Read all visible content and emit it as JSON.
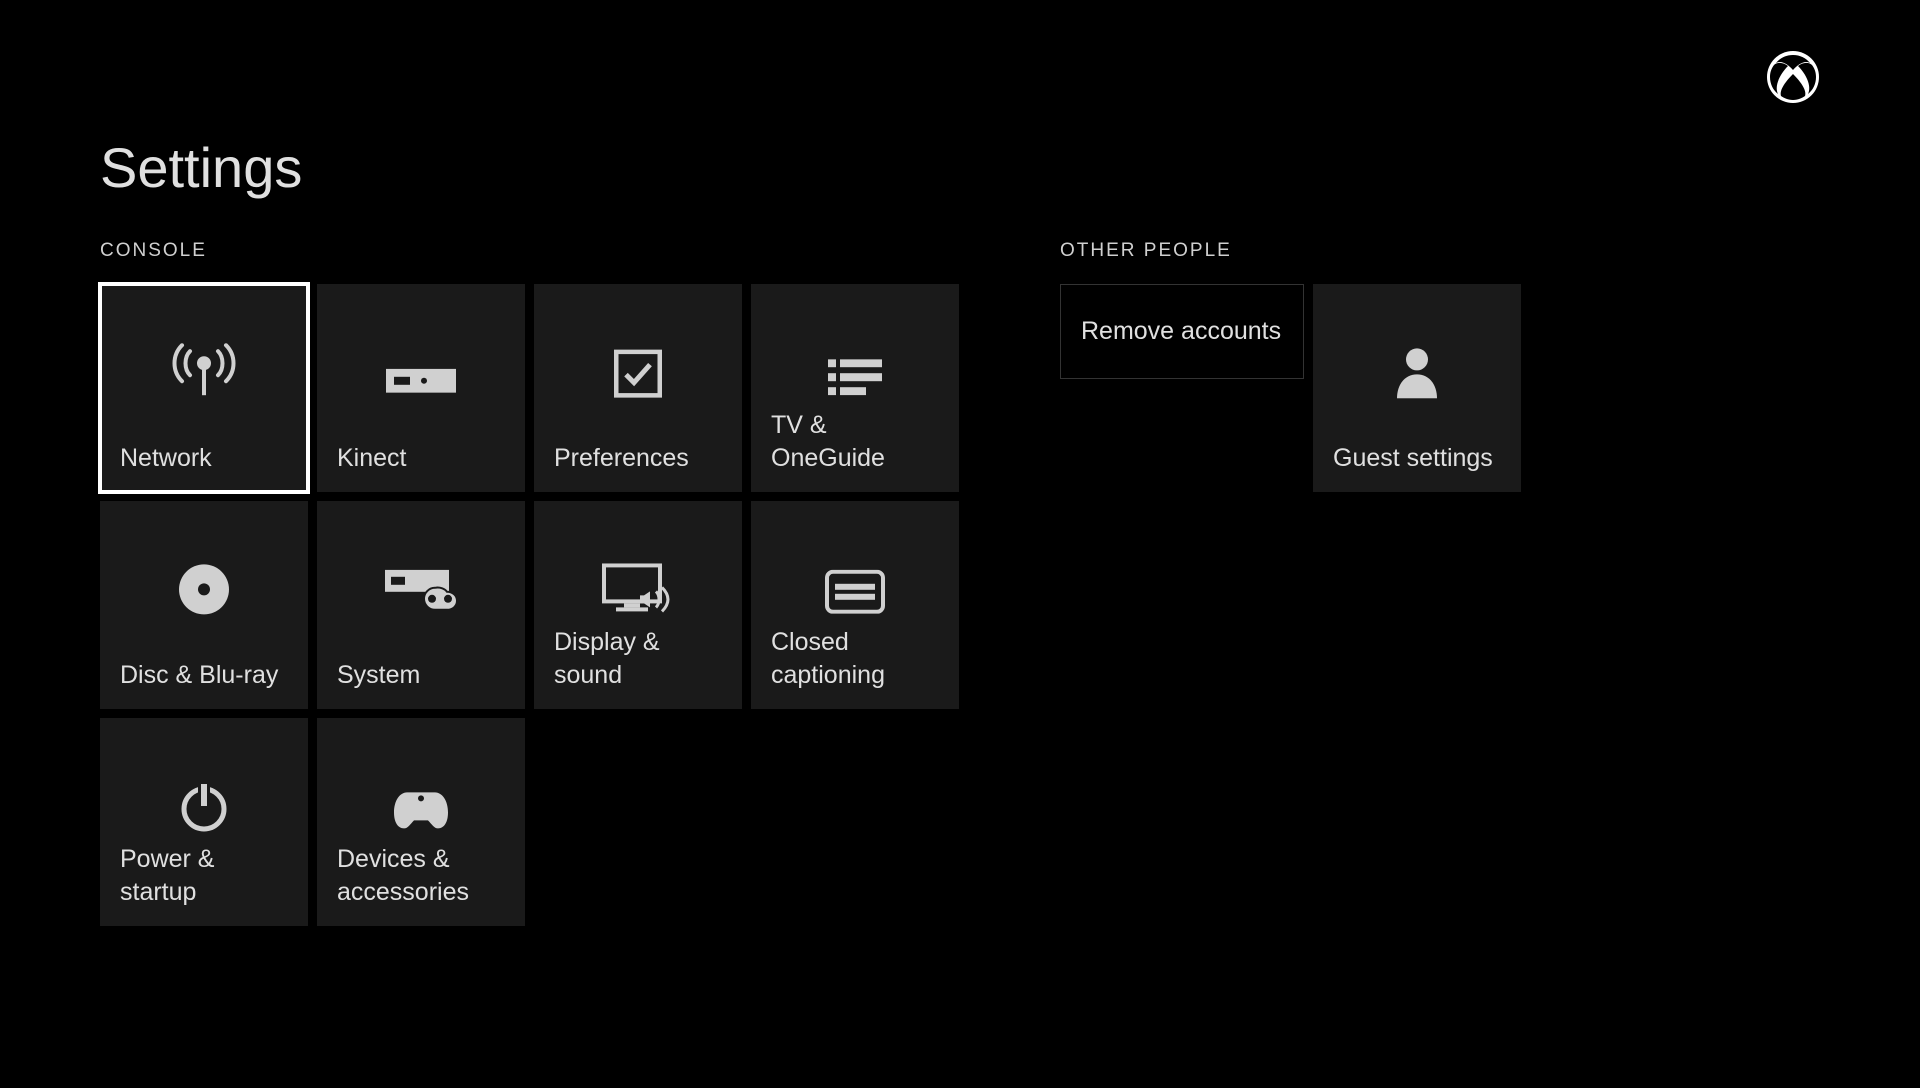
{
  "page": {
    "title": "Settings"
  },
  "sections": {
    "console": {
      "header": "CONSOLE",
      "tiles": {
        "network": "Network",
        "kinect": "Kinect",
        "preferences": "Preferences",
        "tv_oneguide": "TV & OneGuide",
        "disc_bluray": "Disc & Blu-ray",
        "system": "System",
        "display_sound": "Display & sound",
        "closed_captioning": "Closed captioning",
        "power_startup": "Power & startup",
        "devices_accessories": "Devices & accessories"
      }
    },
    "other_people": {
      "header": "OTHER PEOPLE",
      "remove_accounts": "Remove accounts",
      "guest_settings": "Guest settings"
    }
  }
}
